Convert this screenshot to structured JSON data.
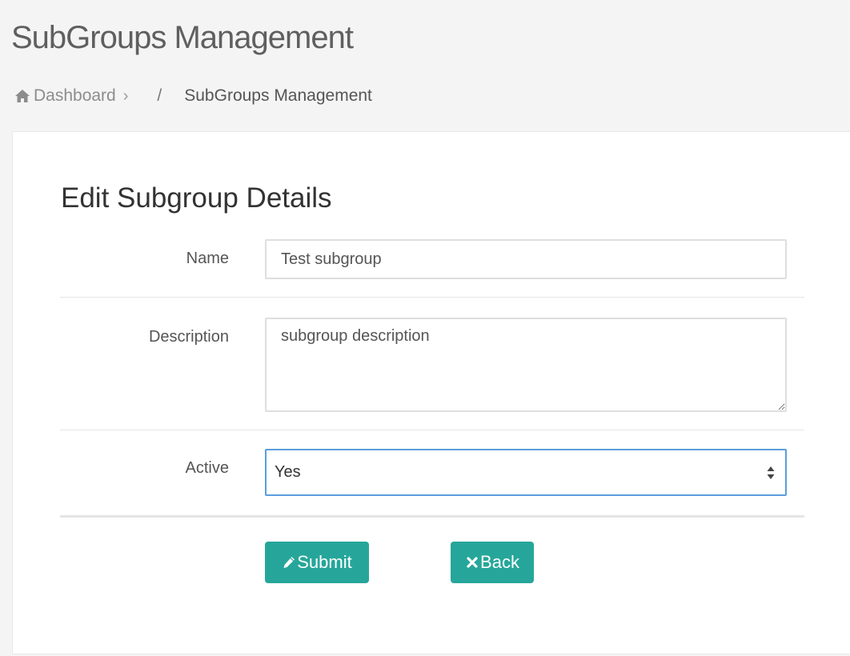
{
  "page": {
    "title": "SubGroups Management"
  },
  "breadcrumb": {
    "home_icon": "home-icon",
    "home_label": "Dashboard",
    "chevron": "›",
    "separator": "/",
    "current": "SubGroups Management"
  },
  "form": {
    "heading": "Edit Subgroup Details",
    "name": {
      "label": "Name",
      "value": "Test subgroup"
    },
    "description": {
      "label": "Description",
      "value": "subgroup description"
    },
    "active": {
      "label": "Active",
      "selected": "Yes"
    }
  },
  "buttons": {
    "submit_label": "Submit",
    "submit_icon": "pencil-icon",
    "back_label": "Back",
    "back_icon": "close-icon"
  },
  "colors": {
    "accent": "#26a69a",
    "focus_border": "#5b9ddd"
  }
}
